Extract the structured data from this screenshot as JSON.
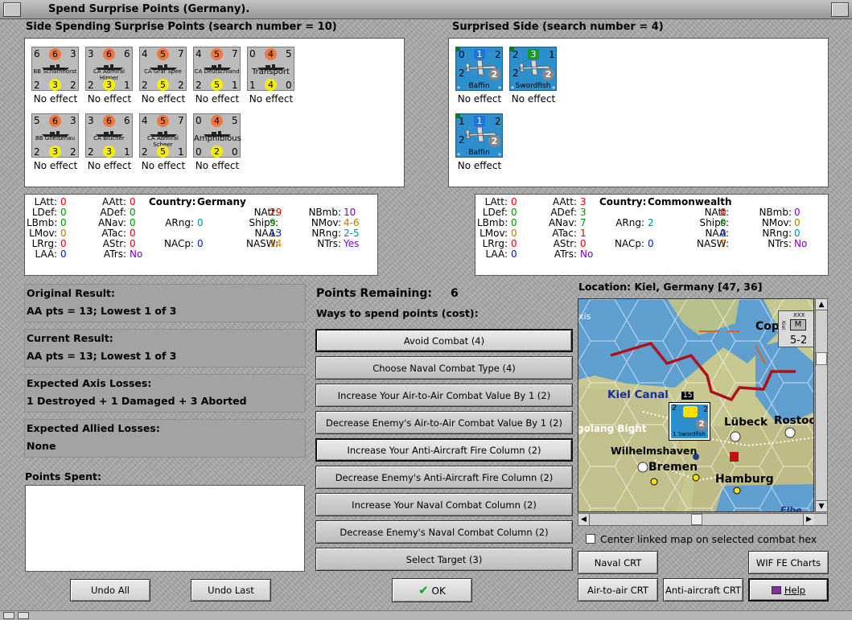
{
  "title": "Spend Surprise Points (Germany).",
  "left_panel": {
    "header": "Side Spending Surprise Points (search number = 10)",
    "units": [
      {
        "name": "BB Scharnhorst",
        "tl": "6",
        "tm": "6",
        "tr": "3",
        "bl": "2",
        "bm": "3",
        "br": "2",
        "effect": "No effect"
      },
      {
        "name": "CA Admiral Hipper",
        "tl": "3",
        "tm": "6",
        "tr": "6",
        "bl": "2",
        "bm": "3",
        "br": "1",
        "effect": "No effect"
      },
      {
        "name": "CA Graf Spee",
        "tl": "4",
        "tm": "5",
        "tr": "7",
        "bl": "2",
        "bm": "5",
        "br": "2",
        "effect": "No effect"
      },
      {
        "name": "CA Deutschland",
        "tl": "4",
        "tm": "5",
        "tr": "7",
        "bl": "2",
        "bm": "5",
        "br": "1",
        "effect": "No effect"
      },
      {
        "name": "Transport",
        "tl": "0",
        "tm": "4",
        "tr": "5",
        "bl": "1",
        "bm": "4",
        "br": "0",
        "effect": "No effect"
      },
      {
        "name": "BB Gneisenau",
        "tl": "5",
        "tm": "6",
        "tr": "3",
        "bl": "2",
        "bm": "3",
        "br": "2",
        "effect": "No effect"
      },
      {
        "name": "CA Blücher",
        "tl": "3",
        "tm": "6",
        "tr": "6",
        "bl": "2",
        "bm": "3",
        "br": "1",
        "effect": "No effect"
      },
      {
        "name": "CA Admiral Scheer",
        "tl": "4",
        "tm": "5",
        "tr": "7",
        "bl": "2",
        "bm": "5",
        "br": "1",
        "effect": "No effect"
      },
      {
        "name": "Amphibious",
        "tl": "0",
        "tm": "4",
        "tr": "5",
        "bl": "0",
        "bm": "2",
        "br": "0",
        "effect": "No effect"
      }
    ]
  },
  "right_panel": {
    "header": "Surprised Side (search number = 4)",
    "units": [
      {
        "name": "Baffin",
        "tl": "0",
        "tm": "1",
        "tr": "2",
        "bl": "2",
        "bm": "2",
        "effect": "No effect",
        "sq": "#1e73e0"
      },
      {
        "name": "Swordfish",
        "tl": "2",
        "tm": "3",
        "tr": "1",
        "bl": "2",
        "bm": "2",
        "effect": "No effect",
        "sq": "#169a2a"
      },
      {
        "name": "Baffin",
        "tl": "1",
        "tm": "1",
        "tr": "2",
        "bl": "2",
        "bm": "2",
        "effect": "No effect",
        "sq": "#1e73e0"
      }
    ]
  },
  "stats_left": {
    "country_label": "Country:",
    "country": "Germany",
    "c1": [
      {
        "k": "LAtt:",
        "v": "0",
        "c": "#e00000"
      },
      {
        "k": "LDef:",
        "v": "0",
        "c": "#009000"
      },
      {
        "k": "LBmb:",
        "v": "0",
        "c": "#009000"
      },
      {
        "k": "LMov:",
        "v": "0",
        "c": "#b08000"
      },
      {
        "k": "LRrg:",
        "v": "0",
        "c": "#e00000"
      },
      {
        "k": "LAA:",
        "v": "0",
        "c": "#0020c0"
      }
    ],
    "c2": [
      {
        "k": "AAtt:",
        "v": "0",
        "c": "#e00000"
      },
      {
        "k": "ADef:",
        "v": "0",
        "c": "#009000"
      },
      {
        "k": "ANav:",
        "v": "0",
        "c": "#009000"
      },
      {
        "k": "ATac:",
        "v": "0",
        "c": "#e00000"
      },
      {
        "k": "AStr:",
        "v": "0",
        "c": "#e00000"
      },
      {
        "k": "ATrs:",
        "v": "No",
        "c": "#8000c0"
      }
    ],
    "c3": [
      {
        "k": "ARng:",
        "v": "0",
        "c": "#009090",
        "row": 2
      },
      {
        "k": "NACp:",
        "v": "0",
        "c": "#0020c0",
        "row": 4
      }
    ],
    "c4": [
      {
        "k": "NAtt:",
        "v": "29",
        "c": "#e00000"
      },
      {
        "k": "Ships:",
        "v": "9",
        "c": "#009000"
      },
      {
        "k": "NAA:",
        "v": "13",
        "c": "#0020c0"
      },
      {
        "k": "NASW:",
        "v": "14",
        "c": "#e08000"
      }
    ],
    "c5": [
      {
        "k": "NBmb:",
        "v": "10",
        "c": "#8000c0"
      },
      {
        "k": "NMov:",
        "v": "4-6",
        "c": "#b08000"
      },
      {
        "k": "NRng:",
        "v": "2-5",
        "c": "#009090"
      },
      {
        "k": "NTrs:",
        "v": "Yes",
        "c": "#8000c0"
      }
    ]
  },
  "stats_right": {
    "country_label": "Country:",
    "country": "Commonwealth",
    "c1": [
      {
        "k": "LAtt:",
        "v": "0",
        "c": "#e00000"
      },
      {
        "k": "LDef:",
        "v": "0",
        "c": "#009000"
      },
      {
        "k": "LBmb:",
        "v": "0",
        "c": "#009000"
      },
      {
        "k": "LMov:",
        "v": "0",
        "c": "#b08000"
      },
      {
        "k": "LRrg:",
        "v": "0",
        "c": "#e00000"
      },
      {
        "k": "LAA:",
        "v": "0",
        "c": "#0020c0"
      }
    ],
    "c2": [
      {
        "k": "AAtt:",
        "v": "3",
        "c": "#e00000"
      },
      {
        "k": "ADef:",
        "v": "3",
        "c": "#009000"
      },
      {
        "k": "ANav:",
        "v": "7",
        "c": "#009000"
      },
      {
        "k": "ATac:",
        "v": "1",
        "c": "#e00000"
      },
      {
        "k": "AStr:",
        "v": "0",
        "c": "#e00000"
      },
      {
        "k": "ATrs:",
        "v": "No",
        "c": "#8000c0"
      }
    ],
    "c3": [
      {
        "k": "ARng:",
        "v": "2",
        "c": "#009090",
        "row": 2
      },
      {
        "k": "NACp:",
        "v": "0",
        "c": "#0020c0",
        "row": 4
      }
    ],
    "c4": [
      {
        "k": "NAtt:",
        "v": "0",
        "c": "#e00000"
      },
      {
        "k": "Ships:",
        "v": "0",
        "c": "#009000"
      },
      {
        "k": "NAA:",
        "v": "0",
        "c": "#0020c0"
      },
      {
        "k": "NASW:",
        "v": "7",
        "c": "#e08000"
      }
    ],
    "c5": [
      {
        "k": "NBmb:",
        "v": "0",
        "c": "#8000c0"
      },
      {
        "k": "NMov:",
        "v": "0",
        "c": "#b08000"
      },
      {
        "k": "NRng:",
        "v": "0",
        "c": "#009090"
      },
      {
        "k": "NTrs:",
        "v": "No",
        "c": "#8000c0"
      }
    ]
  },
  "results": [
    {
      "label": "Original Result:",
      "value": "AA pts = 13; Lowest 1 of 3"
    },
    {
      "label": "Current Result:",
      "value": "AA pts = 13; Lowest 1 of 3"
    },
    {
      "label": "Expected Axis Losses:",
      "value": "1 Destroyed + 1 Damaged + 3 Aborted"
    },
    {
      "label": "Expected Allied Losses:",
      "value": "None"
    }
  ],
  "points_spent_label": "Points Spent:",
  "points_remaining_label": "Points Remaining:",
  "points_remaining": "6",
  "ways_label": "Ways to spend points (cost):",
  "options": [
    "Avoid Combat (4)",
    "Choose Naval Combat Type (4)",
    "Increase Your Air-to-Air Combat Value By 1 (2)",
    "Decrease Enemy's Air-to-Air Combat Value By 1 (2)",
    "Increase Your Anti-Aircraft Fire Column (2)",
    "Decrease Enemy's Anti-Aircraft Fire Column (2)",
    "Increase Your Naval Combat Column (2)",
    "Decrease Enemy's Naval Combat Column (2)",
    "Select Target (3)"
  ],
  "buttons": {
    "undo_all": "Undo All",
    "undo_last": "Undo Last",
    "ok": "OK",
    "ok_icon": "checkmark-icon",
    "naval_crt": "Naval CRT",
    "wif_charts": "WIF FE Charts",
    "air_crt": "Air-to-air CRT",
    "aa_crt": "Anti-aircraft CRT",
    "help": "Help",
    "help_icon": "book-icon"
  },
  "location": "Location: Kiel, Germany [47, 36]",
  "map": {
    "labels": [
      "Copen",
      "Kiel Canal",
      "golang Bight",
      "Lübeck",
      "Rostoc",
      "Wilhelmshaven",
      "Bremen",
      "Hamburg",
      "Elbe",
      "xis"
    ],
    "corps": {
      "type": "XXX",
      "val": "5-2",
      "side": "Kiel"
    },
    "stack_count": "15",
    "unit": {
      "name": "Swordfish",
      "a": "2",
      "b": "2",
      "c": "1",
      "d": "2"
    }
  },
  "center_map_label": "Center linked map on selected combat hex",
  "center_map_checked": false
}
